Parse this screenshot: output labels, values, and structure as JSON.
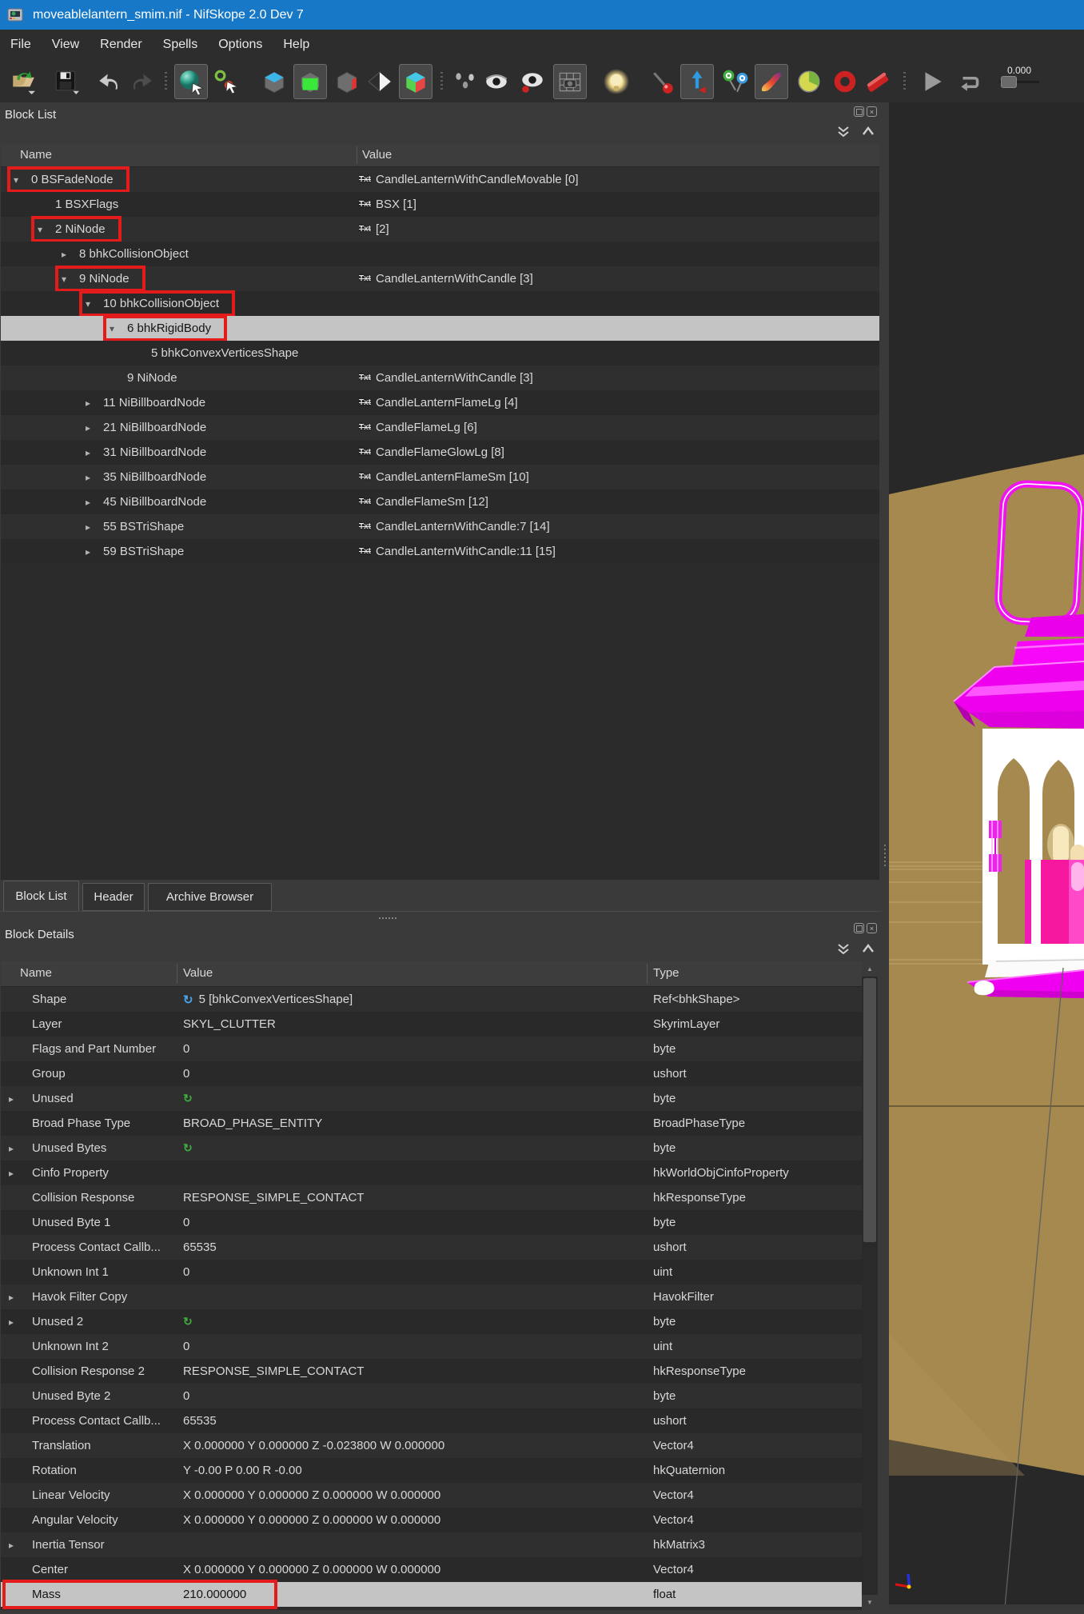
{
  "window": {
    "title": "moveablelantern_smim.nif - NifSkope 2.0 Dev 7"
  },
  "menu": {
    "items": [
      "File",
      "View",
      "Render",
      "Spells",
      "Options",
      "Help"
    ]
  },
  "toolbar": {
    "buttons": [
      {
        "name": "open-file-button"
      },
      {
        "name": "save-file-button"
      },
      {
        "name": "undo-button"
      },
      {
        "name": "redo-button"
      },
      {
        "sep": true
      },
      {
        "name": "select-sphere-button",
        "pressed": true
      },
      {
        "name": "select-nodes-button"
      },
      {
        "name": "view-top-cube-button"
      },
      {
        "name": "view-front-cube-button",
        "pressed": true
      },
      {
        "name": "view-side-cube-button"
      },
      {
        "name": "flip-diamond-button"
      },
      {
        "name": "perspective-cube-button",
        "pressed": true
      },
      {
        "sep": true
      },
      {
        "name": "show-vertices-button"
      },
      {
        "name": "show-nodes-eye-button"
      },
      {
        "name": "show-hidden-eye-button"
      },
      {
        "name": "screenshot-grid-button",
        "pressed": true
      },
      {
        "name": "lighting-bulb-button"
      },
      {
        "name": "marker-pin-button"
      },
      {
        "name": "show-axes-button",
        "pressed": true
      },
      {
        "name": "constraints-pins-button"
      },
      {
        "name": "flame-brush-button",
        "pressed": true
      },
      {
        "name": "time-pie-button"
      },
      {
        "name": "ring-marker-button"
      },
      {
        "name": "erase-slash-button"
      },
      {
        "sep": true
      },
      {
        "name": "play-button"
      },
      {
        "name": "loop-button"
      },
      {
        "slider": true
      }
    ],
    "time_value": "0.000"
  },
  "block_list": {
    "title": "Block List",
    "columns": [
      "Name",
      "Value"
    ],
    "rows": [
      {
        "indent": 0,
        "arrow": "down",
        "name": "0 BSFadeNode",
        "value": "CandleLanternWithCandleMovable [0]",
        "txt": true,
        "boxed": true
      },
      {
        "indent": 1,
        "arrow": "none",
        "name": "1 BSXFlags",
        "value": "BSX [1]",
        "txt": true
      },
      {
        "indent": 1,
        "arrow": "down",
        "name": "2 NiNode",
        "value": "[2]",
        "txt": true,
        "boxed": true
      },
      {
        "indent": 2,
        "arrow": "right",
        "name": "8 bhkCollisionObject",
        "value": "",
        "txt": false
      },
      {
        "indent": 2,
        "arrow": "down",
        "name": "9 NiNode",
        "value": "CandleLanternWithCandle [3]",
        "txt": true,
        "boxed": true
      },
      {
        "indent": 3,
        "arrow": "down",
        "name": "10 bhkCollisionObject",
        "value": "",
        "txt": false,
        "boxed": true
      },
      {
        "indent": 4,
        "arrow": "down",
        "name": "6 bhkRigidBody",
        "value": "",
        "txt": false,
        "boxed": true,
        "selected": true
      },
      {
        "indent": 5,
        "arrow": "none",
        "name": "5 bhkConvexVerticesShape",
        "value": "",
        "txt": false
      },
      {
        "indent": 4,
        "arrow": "none",
        "name": "9 NiNode",
        "value": "CandleLanternWithCandle [3]",
        "txt": true
      },
      {
        "indent": 3,
        "arrow": "right",
        "name": "11 NiBillboardNode",
        "value": "CandleLanternFlameLg [4]",
        "txt": true
      },
      {
        "indent": 3,
        "arrow": "right",
        "name": "21 NiBillboardNode",
        "value": "CandleFlameLg [6]",
        "txt": true
      },
      {
        "indent": 3,
        "arrow": "right",
        "name": "31 NiBillboardNode",
        "value": "CandleFlameGlowLg [8]",
        "txt": true
      },
      {
        "indent": 3,
        "arrow": "right",
        "name": "35 NiBillboardNode",
        "value": "CandleLanternFlameSm [10]",
        "txt": true
      },
      {
        "indent": 3,
        "arrow": "right",
        "name": "45 NiBillboardNode",
        "value": "CandleFlameSm [12]",
        "txt": true
      },
      {
        "indent": 3,
        "arrow": "right",
        "name": "55 BSTriShape",
        "value": "CandleLanternWithCandle:7 [14]",
        "txt": true
      },
      {
        "indent": 3,
        "arrow": "right",
        "name": "59 BSTriShape",
        "value": "CandleLanternWithCandle:11 [15]",
        "txt": true
      }
    ]
  },
  "tabs": [
    {
      "label": "Block List",
      "active": true
    },
    {
      "label": "Header",
      "active": false
    },
    {
      "label": "Archive Browser",
      "active": false
    }
  ],
  "block_details": {
    "title": "Block Details",
    "columns": [
      "Name",
      "Value",
      "Type"
    ],
    "rows": [
      {
        "name": "Shape",
        "value": "5 [bhkConvexVerticesShape]",
        "type": "Ref<bhkShape>",
        "icon": "ref"
      },
      {
        "name": "Layer",
        "value": "SKYL_CLUTTER",
        "type": "SkyrimLayer"
      },
      {
        "name": "Flags and Part Number",
        "value": "0",
        "type": "byte"
      },
      {
        "name": "Group",
        "value": "0",
        "type": "ushort"
      },
      {
        "name": "Unused",
        "value": "",
        "type": "byte",
        "arrow": true,
        "icon": "recycle"
      },
      {
        "name": "Broad Phase Type",
        "value": "BROAD_PHASE_ENTITY",
        "type": "BroadPhaseType"
      },
      {
        "name": "Unused Bytes",
        "value": "",
        "type": "byte",
        "arrow": true,
        "icon": "recycle"
      },
      {
        "name": "Cinfo Property",
        "value": "",
        "type": "hkWorldObjCinfoProperty",
        "arrow": true
      },
      {
        "name": "Collision Response",
        "value": "RESPONSE_SIMPLE_CONTACT",
        "type": "hkResponseType"
      },
      {
        "name": "Unused Byte 1",
        "value": "0",
        "type": "byte"
      },
      {
        "name": "Process Contact Callb...",
        "value": "65535",
        "type": "ushort"
      },
      {
        "name": "Unknown Int 1",
        "value": "0",
        "type": "uint"
      },
      {
        "name": "Havok Filter Copy",
        "value": "",
        "type": "HavokFilter",
        "arrow": true
      },
      {
        "name": "Unused 2",
        "value": "",
        "type": "byte",
        "arrow": true,
        "icon": "recycle"
      },
      {
        "name": "Unknown Int 2",
        "value": "0",
        "type": "uint"
      },
      {
        "name": "Collision Response 2",
        "value": "RESPONSE_SIMPLE_CONTACT",
        "type": "hkResponseType"
      },
      {
        "name": "Unused Byte 2",
        "value": "0",
        "type": "byte"
      },
      {
        "name": "Process Contact Callb...",
        "value": "65535",
        "type": "ushort"
      },
      {
        "name": "Translation",
        "value": "X 0.000000 Y 0.000000 Z -0.023800 W 0.000000",
        "type": "Vector4"
      },
      {
        "name": "Rotation",
        "value": "Y -0.00 P 0.00 R -0.00",
        "type": "hkQuaternion"
      },
      {
        "name": "Linear Velocity",
        "value": "X 0.000000 Y 0.000000 Z 0.000000 W 0.000000",
        "type": "Vector4"
      },
      {
        "name": "Angular Velocity",
        "value": "X 0.000000 Y 0.000000 Z 0.000000 W 0.000000",
        "type": "Vector4"
      },
      {
        "name": "Inertia Tensor",
        "value": "",
        "type": "hkMatrix3",
        "arrow": true
      },
      {
        "name": "Center",
        "value": "X 0.000000 Y 0.000000 Z 0.000000 W 0.000000",
        "type": "Vector4"
      },
      {
        "name": "Mass",
        "value": "210.000000",
        "type": "float",
        "selected": true,
        "boxed": true
      }
    ]
  },
  "colors": {
    "titlebar": "#1878c8",
    "accent_red": "#e31b1b",
    "viewport_ground": "#a5894f",
    "lantern_magenta": "#f000f0",
    "lantern_white": "#ffffff",
    "candle_pink": "#f5189f"
  }
}
